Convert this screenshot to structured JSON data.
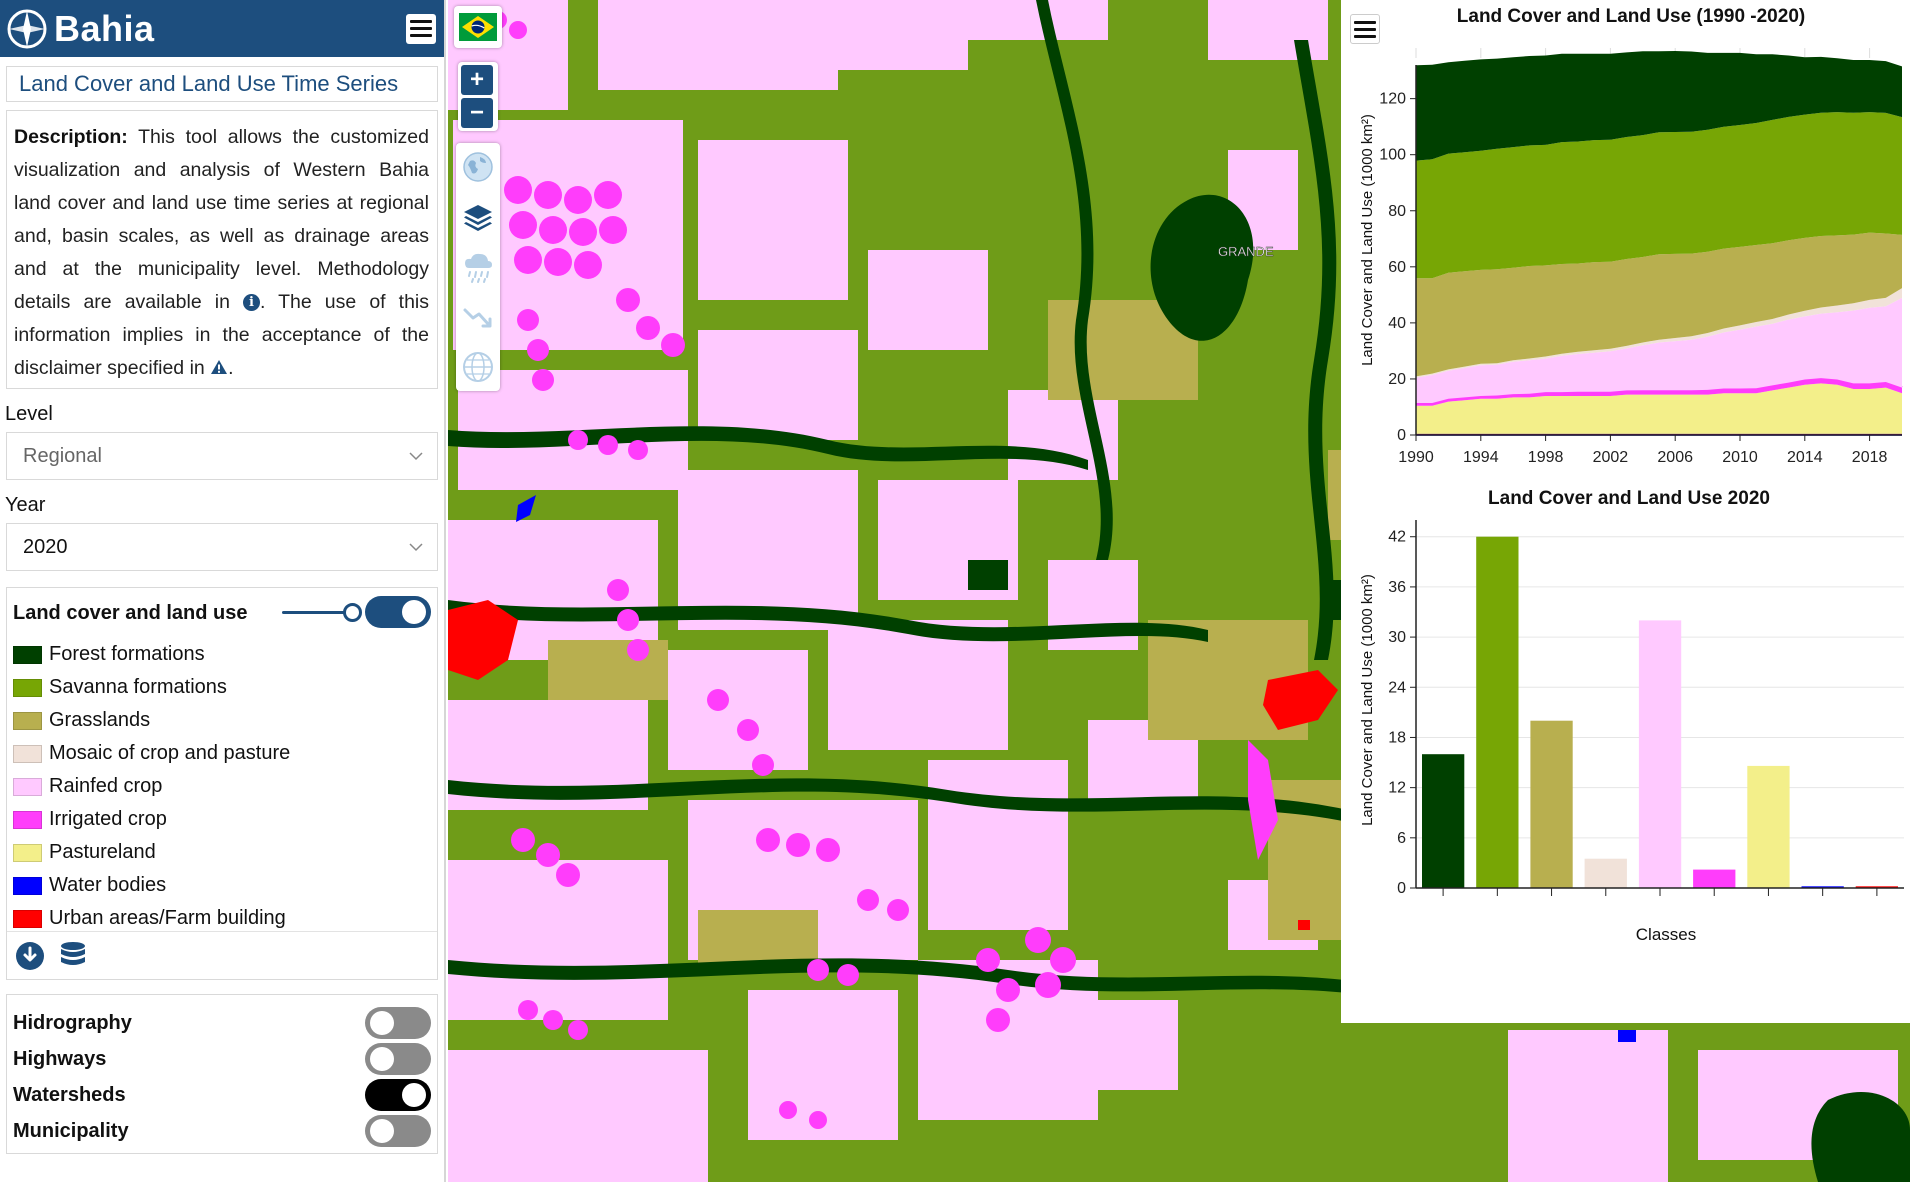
{
  "app": {
    "brand": "Bahia"
  },
  "sidebar": {
    "tool_title": "Land Cover and Land Use Time Series",
    "description": {
      "bold": "Description:",
      "text1": " This tool allows the customized visualization and analysis of Western Bahia land cover and land use time series at regional and, basin scales, as well as drainage areas and at the municipality level. Methodology details are available in ",
      "text2": ". The use of this information implies in the acceptance of the disclaimer specified in ",
      "text3": "."
    },
    "level": {
      "label": "Level",
      "value": "Regional"
    },
    "year": {
      "label": "Year",
      "value": "2020"
    },
    "legend": {
      "title": "Land cover and land use",
      "enabled": true,
      "items": [
        {
          "label": "Forest formations",
          "color": "#004000"
        },
        {
          "label": "Savanna formations",
          "color": "#77a605"
        },
        {
          "label": "Grasslands",
          "color": "#b8af4f"
        },
        {
          "label": "Mosaic of crop and pasture",
          "color": "#f1e2d9"
        },
        {
          "label": "Rainfed crop",
          "color": "#ffc9ff"
        },
        {
          "label": "Irrigated crop",
          "color": "#ff3dfb"
        },
        {
          "label": "Pastureland",
          "color": "#f3ef8a"
        },
        {
          "label": "Water bodies",
          "color": "#0000ff"
        },
        {
          "label": "Urban areas/Farm building",
          "color": "#ff0000"
        }
      ]
    },
    "layers": [
      {
        "label": "Hidrography",
        "on": false
      },
      {
        "label": "Highways",
        "on": false
      },
      {
        "label": "Watersheds",
        "on": true
      },
      {
        "label": "Municipality",
        "on": false
      }
    ]
  },
  "map": {
    "place_label": "GRANDE"
  },
  "charts": {
    "accent": "#1d4e7e",
    "chart_data": [
      {
        "type": "area",
        "title": "Land Cover and Land Use (1990 -2020)",
        "ylabel": "Land Cover and Land Use (1000 km²)",
        "xlabel": "",
        "ylim": [
          0,
          132
        ],
        "xlim": [
          1990,
          2020
        ],
        "yticks": [
          0,
          20,
          40,
          60,
          80,
          100,
          120
        ],
        "xticks": [
          1990,
          1994,
          1998,
          2002,
          2006,
          2010,
          2014,
          2018
        ],
        "stacked": true,
        "x": [
          1990,
          1991,
          1992,
          1993,
          1994,
          1995,
          1996,
          1997,
          1998,
          1999,
          2000,
          2001,
          2002,
          2003,
          2004,
          2005,
          2006,
          2007,
          2008,
          2009,
          2010,
          2011,
          2012,
          2013,
          2014,
          2015,
          2016,
          2017,
          2018,
          2019,
          2020
        ],
        "series": [
          {
            "name": "Water bodies",
            "color": "#0000ff",
            "values": [
              0.3,
              0.3,
              0.3,
              0.3,
              0.3,
              0.3,
              0.3,
              0.3,
              0.3,
              0.3,
              0.3,
              0.3,
              0.3,
              0.3,
              0.3,
              0.3,
              0.3,
              0.3,
              0.3,
              0.3,
              0.3,
              0.3,
              0.3,
              0.3,
              0.3,
              0.3,
              0.3,
              0.3,
              0.3,
              0.3,
              0.3
            ]
          },
          {
            "name": "Urban areas/Farm building",
            "color": "#ff0000",
            "values": [
              0.1,
              0.1,
              0.1,
              0.1,
              0.1,
              0.1,
              0.1,
              0.1,
              0.1,
              0.1,
              0.1,
              0.1,
              0.1,
              0.1,
              0.1,
              0.1,
              0.1,
              0.1,
              0.1,
              0.1,
              0.1,
              0.1,
              0.1,
              0.1,
              0.1,
              0.1,
              0.1,
              0.1,
              0.1,
              0.1,
              0.1
            ]
          },
          {
            "name": "Pastureland",
            "color": "#f3ef8a",
            "values": [
              10,
              10,
              11.5,
              12,
              12.5,
              12.5,
              13,
              13,
              13.5,
              13.5,
              13.5,
              13.5,
              13.5,
              14,
              14,
              14,
              14,
              14,
              14,
              14.5,
              14.5,
              14.5,
              15.5,
              16.5,
              17.5,
              18,
              17.5,
              16,
              16,
              16.5,
              14.5
            ]
          },
          {
            "name": "Irrigated crop",
            "color": "#ff3dfb",
            "values": [
              1,
              1,
              1,
              1,
              1,
              1.2,
              1.2,
              1.3,
              1.4,
              1.4,
              1.5,
              1.5,
              1.5,
              1.5,
              1.6,
              1.6,
              1.6,
              1.6,
              1.7,
              1.7,
              1.7,
              1.8,
              1.8,
              1.8,
              1.9,
              1.9,
              1.9,
              2,
              2,
              2,
              2
            ]
          },
          {
            "name": "Rainfed crop",
            "color": "#ffc9ff",
            "values": [
              9,
              10,
              10,
              10.5,
              11,
              11,
              11.5,
              12,
              12,
              13,
              13.5,
              14,
              14.5,
              15,
              16,
              17,
              17.5,
              18,
              19,
              20,
              21,
              22,
              22,
              22.5,
              22.5,
              23,
              24,
              26,
              27,
              27,
              32
            ]
          },
          {
            "name": "Mosaic of crop and pasture",
            "color": "#f1e2d9",
            "values": [
              0.5,
              0.5,
              0.5,
              0.5,
              0.5,
              0.5,
              0.6,
              0.6,
              0.7,
              0.7,
              0.8,
              0.8,
              0.9,
              0.9,
              1,
              1,
              1.1,
              1.2,
              1.3,
              1.4,
              1.5,
              1.6,
              1.7,
              1.8,
              2,
              2.2,
              2.4,
              2.6,
              2.8,
              3,
              3.5
            ]
          },
          {
            "name": "Grasslands",
            "color": "#b8af4f",
            "values": [
              35,
              34,
              34.5,
              34,
              33.5,
              33.5,
              33,
              33,
              32.5,
              32,
              31.5,
              31.5,
              31,
              31,
              30.5,
              30.5,
              30,
              29.5,
              29,
              28.5,
              28,
              27.5,
              27,
              26.5,
              26,
              25.5,
              25,
              24.5,
              24,
              23,
              19
            ]
          },
          {
            "name": "Savanna formations",
            "color": "#77a605",
            "values": [
              42,
              42.5,
              42.5,
              42.5,
              42.5,
              43,
              43,
              43,
              43,
              43.5,
              43.5,
              43.5,
              43.5,
              43.5,
              43.5,
              43.5,
              43.5,
              43.5,
              43.5,
              43.5,
              43.5,
              43.5,
              44,
              44,
              44,
              44,
              44,
              43.5,
              43,
              43,
              42
            ]
          },
          {
            "name": "Forest formations",
            "color": "#004000",
            "values": [
              34,
              33.7,
              32.6,
              32.6,
              32.6,
              32.2,
              32.1,
              31.9,
              31.9,
              31.5,
              31.3,
              30.8,
              30.7,
              30.2,
              29.9,
              28.9,
              28.9,
              28.6,
              27.4,
              26.3,
              25.7,
              24.5,
              23.4,
              21.9,
              20.5,
              19.9,
              19.2,
              18.8,
              18.6,
              18.5,
              18.1
            ]
          }
        ]
      },
      {
        "type": "bar",
        "title": "Land Cover and Land Use 2020",
        "xlabel": "Classes",
        "ylabel": "Land Cover and Land Use (1000 km²)",
        "ylim": [
          0,
          44
        ],
        "yticks": [
          0,
          6,
          12,
          18,
          24,
          30,
          36,
          42
        ],
        "categories": [
          "Forest formations",
          "Savanna formations",
          "Grasslands",
          "Mosaic of crop and pasture",
          "Rainfed crop",
          "Irrigated crop",
          "Pastureland",
          "Water bodies",
          "Urban areas/Farm building"
        ],
        "values": [
          16,
          42,
          20,
          3.5,
          32,
          2.2,
          14.6,
          0.2,
          0.2
        ],
        "colors": [
          "#004000",
          "#77a605",
          "#b8af4f",
          "#f1e2d9",
          "#ffc9ff",
          "#ff3dfb",
          "#f3ef8a",
          "#0000ff",
          "#ff0000"
        ]
      }
    ]
  }
}
